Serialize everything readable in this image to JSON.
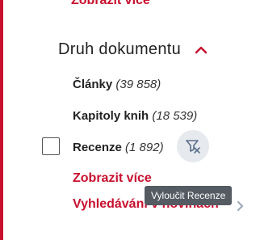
{
  "top_link": "Zobrazit více",
  "section": {
    "title": "Druh dokumentu"
  },
  "facets": [
    {
      "label": "Články",
      "count": "(39 858)"
    },
    {
      "label": "Kapitoly knih",
      "count": "(18 539)"
    },
    {
      "label": "Recenze",
      "count": "(1 892)"
    }
  ],
  "show_more": "Zobrazit více",
  "news_search": "Vyhledávání v novinách",
  "tooltip": "Vyloučit Recenze",
  "colors": {
    "accent": "#c8102e",
    "tooltip_bg": "#555b62",
    "button_bg": "#e6e9ee"
  },
  "icons": {
    "collapse": "chevron-up-icon",
    "exclude": "exclude-filter-icon"
  }
}
